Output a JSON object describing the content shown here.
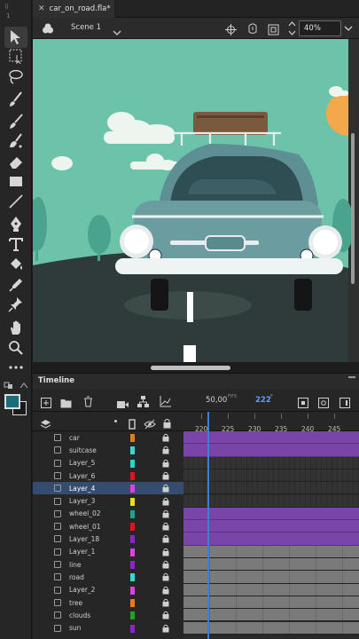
{
  "document": {
    "tab_title": "car_on_road.fla*",
    "scene_label": "Scene 1",
    "zoom_value": "40%"
  },
  "tools": [
    {
      "name": "selection-tool-icon",
      "selected": true
    },
    {
      "name": "free-transform-tool-icon"
    },
    {
      "name": "lasso-tool-icon"
    },
    {
      "name": "paint-brush-tool-icon"
    },
    {
      "name": "brush-tool-icon"
    },
    {
      "name": "fluid-brush-tool-icon"
    },
    {
      "name": "eraser-tool-icon"
    },
    {
      "name": "rectangle-tool-icon"
    },
    {
      "name": "line-tool-icon"
    },
    {
      "name": "pen-tool-icon"
    },
    {
      "name": "text-tool-icon"
    },
    {
      "name": "paint-bucket-tool-icon"
    },
    {
      "name": "eyedropper-tool-icon"
    },
    {
      "name": "pin-tool-icon"
    },
    {
      "name": "hand-tool-icon"
    },
    {
      "name": "zoom-tool-icon"
    },
    {
      "name": "more-tools-icon"
    }
  ],
  "colors": {
    "stroke": "#1e6b7a",
    "fill": "#1a1a1a",
    "accent": "#3d7fd4",
    "stage_bg": "#6cc3aa",
    "tween_purple": "#7a45a8"
  },
  "timeline": {
    "panel_title": "Timeline",
    "fps_value": "50,00",
    "fps_unit": "FPS",
    "current_frame": "222",
    "frame_unit": "F",
    "ruler_ticks": [
      "220",
      "225",
      "230",
      "235",
      "240",
      "245"
    ],
    "layers": [
      {
        "name": "car",
        "color": "#e07b1f",
        "active": false,
        "track": "purple"
      },
      {
        "name": "suitcase",
        "color": "#3fd4d4",
        "active": false,
        "track": "purple"
      },
      {
        "name": "Layer_5",
        "color": "#2dd2c8",
        "active": false,
        "track": "dark"
      },
      {
        "name": "Layer_6",
        "color": "#e0141e",
        "active": false,
        "track": "dark"
      },
      {
        "name": "Layer_4",
        "color": "#e040e0",
        "active": true,
        "track": "dark"
      },
      {
        "name": "Layer_3",
        "color": "#e8e020",
        "active": false,
        "track": "dark"
      },
      {
        "name": "wheel_02",
        "color": "#1fa58f",
        "active": false,
        "track": "purple"
      },
      {
        "name": "wheel_01",
        "color": "#e0141e",
        "active": false,
        "track": "purple"
      },
      {
        "name": "Layer_18",
        "color": "#8a25c8",
        "active": false,
        "track": "purple"
      },
      {
        "name": "Layer_1",
        "color": "#e040e0",
        "active": false,
        "track": "grey"
      },
      {
        "name": "line",
        "color": "#8a25c8",
        "active": false,
        "track": "grey"
      },
      {
        "name": "road",
        "color": "#3fd4d4",
        "active": false,
        "track": "grey"
      },
      {
        "name": "Layer_2",
        "color": "#e040e0",
        "active": false,
        "track": "grey"
      },
      {
        "name": "tree",
        "color": "#e07b1f",
        "active": false,
        "track": "grey"
      },
      {
        "name": "clouds",
        "color": "#28a028",
        "active": false,
        "track": "grey"
      },
      {
        "name": "sun",
        "color": "#8a25c8",
        "active": false,
        "track": "grey"
      }
    ]
  }
}
